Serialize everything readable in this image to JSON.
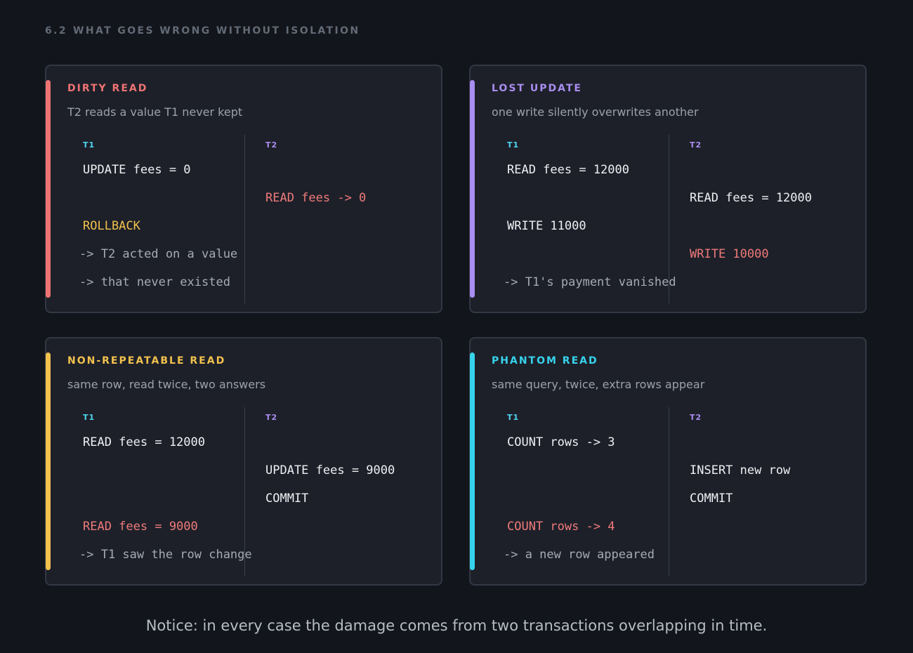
{
  "section": {
    "number": "6.2",
    "title": "WHAT GOES WRONG WITHOUT ISOLATION"
  },
  "colors": {
    "dirty_read": "#f07373",
    "lost_update": "#a98df0",
    "non_repeatable_read": "#f2c14e",
    "phantom_read": "#37d3ec",
    "t1_label": "#4fd5f0",
    "t2_label": "#a98df0",
    "highlight_red": "#f07a7a",
    "highlight_amber": "#f2c14e"
  },
  "cards": {
    "dirty_read": {
      "title": "DIRTY READ",
      "subtitle": "T2 reads a value T1 never kept",
      "t1_label": "T1",
      "t2_label": "T2",
      "t1_update": "UPDATE fees = 0",
      "t2_read": "READ fees -> 0",
      "t1_rollback": "ROLLBACK",
      "note_1": "-> T2 acted on a value",
      "note_2": "-> that never existed"
    },
    "lost_update": {
      "title": "LOST UPDATE",
      "subtitle": "one write silently overwrites another",
      "t1_label": "T1",
      "t2_label": "T2",
      "t1_read": "READ fees = 12000",
      "t2_read": "READ fees = 12000",
      "t1_write": "WRITE 11000",
      "t2_write": "WRITE 10000",
      "note": "-> T1's payment vanished"
    },
    "non_repeatable_read": {
      "title": "NON-REPEATABLE READ",
      "subtitle": "same row, read twice, two answers",
      "t1_label": "T1",
      "t2_label": "T2",
      "t1_read_1": "READ fees = 12000",
      "t2_update": "UPDATE fees = 9000",
      "t2_commit": "COMMIT",
      "t1_read_2": "READ fees = 9000",
      "note": "-> T1 saw the row change"
    },
    "phantom_read": {
      "title": "PHANTOM READ",
      "subtitle": "same query, twice, extra rows appear",
      "t1_label": "T1",
      "t2_label": "T2",
      "t1_count_1": "COUNT rows -> 3",
      "t2_insert": "INSERT new row",
      "t2_commit": "COMMIT",
      "t1_count_2": "COUNT rows -> 4",
      "note": "-> a new row appeared"
    }
  },
  "footer": "Notice: in every case the damage comes from two transactions overlapping in time."
}
